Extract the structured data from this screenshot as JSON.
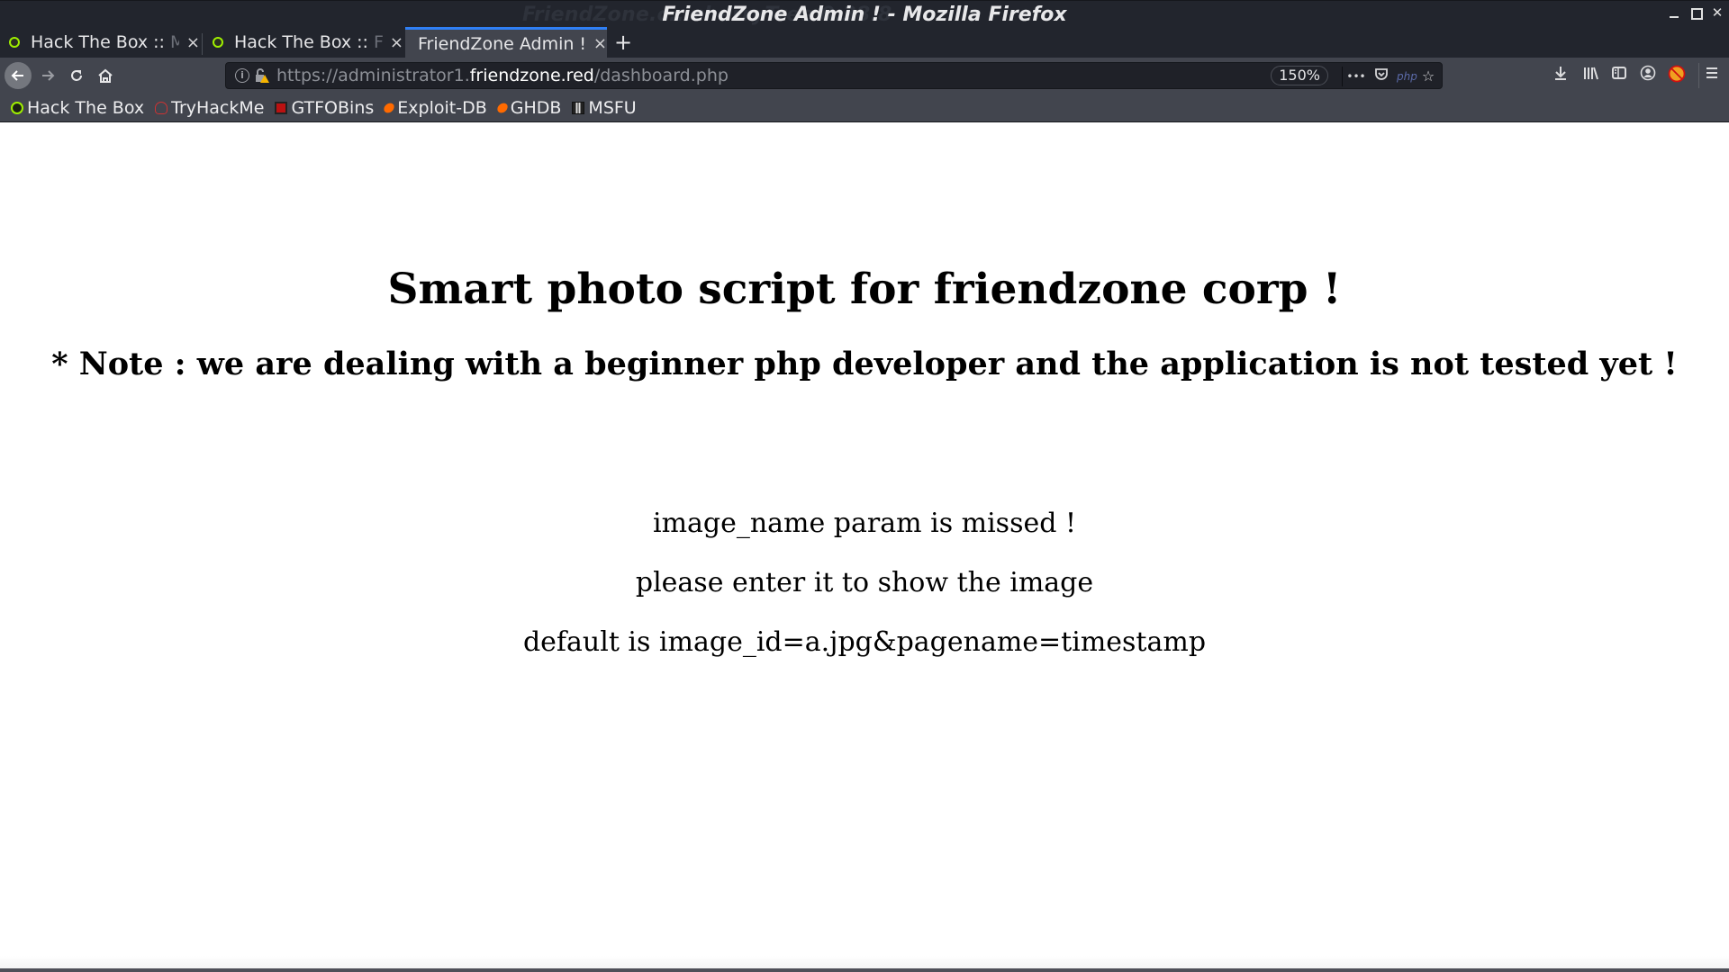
{
  "window": {
    "title": "FriendZone Admin ! - Mozilla Firefox",
    "ghost_title": "FriendZone.c...cherryTree 0.38.8",
    "controls": [
      "minimize",
      "maximize",
      "close"
    ]
  },
  "tabs": [
    {
      "label_visible": "Hack The Box :: ",
      "label_fade": "M",
      "icon": "hackthebox-icon",
      "active": false
    },
    {
      "label_visible": "Hack The Box :: ",
      "label_fade": "F",
      "icon": "hackthebox-icon",
      "active": false
    },
    {
      "label_visible": "FriendZone Admin !",
      "label_fade": "",
      "icon": "",
      "active": true
    }
  ],
  "tab_close_glyph": "×",
  "new_tab_glyph": "+",
  "toolbar": {
    "url_scheme_path_prefix": "https://administrator1.",
    "url_host": "friendzone.red",
    "url_path": "/dashboard.php",
    "zoom_level": "150%",
    "more_glyph": "•••",
    "php_badge": "php",
    "accent_color": "#2f7ff5"
  },
  "bookmarks": [
    {
      "label": "Hack The Box",
      "icon": "hackthebox-icon"
    },
    {
      "label": "TryHackMe",
      "icon": "tryhackme-icon"
    },
    {
      "label": "GTFOBins",
      "icon": "gtfobins-icon"
    },
    {
      "label": "Exploit-DB",
      "icon": "exploitdb-icon"
    },
    {
      "label": "GHDB",
      "icon": "exploitdb-icon"
    },
    {
      "label": "MSFU",
      "icon": "metasploit-icon"
    }
  ],
  "page": {
    "heading": "Smart photo script for friendzone corp !",
    "note": "* Note : we are dealing with a beginner php developer and the application is not tested yet !",
    "messages": [
      "image_name param is missed !",
      "please enter it to show the image",
      "default is image_id=a.jpg&pagename=timestamp"
    ]
  }
}
